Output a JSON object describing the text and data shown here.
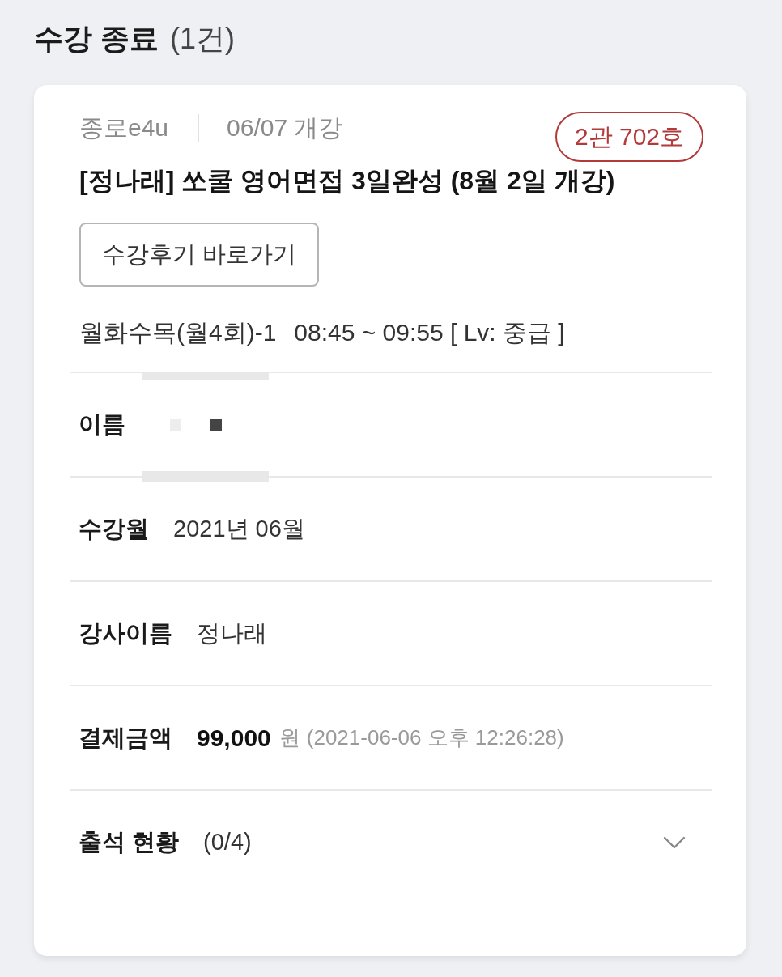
{
  "section": {
    "title": "수강 종료",
    "count": "(1건)"
  },
  "course": {
    "provider": "종로e4u",
    "start": "06/07 개강",
    "room": "2관 702호",
    "title": "[정나래] 쏘쿨 영어면접 3일완성 (8월 2일 개강)",
    "review_button": "수강후기 바로가기",
    "schedule_days": "월화수목(월4회)-1",
    "schedule_time": "08:45 ~ 09:55 [ Lv: 중급 ]"
  },
  "rows": [
    {
      "kind": "redacted",
      "label": "이름"
    },
    {
      "kind": "text",
      "label": "수강월",
      "value": "2021년 06월"
    },
    {
      "kind": "text",
      "label": "강사이름",
      "value": "정나래"
    },
    {
      "kind": "payment",
      "label": "결제금액",
      "amount": "99,000",
      "unit": "원",
      "paid_at": "(2021-06-06 오후 12:26:28)"
    },
    {
      "kind": "expandable",
      "label": "출석 현황",
      "value": "(0/4)",
      "expanded": false
    }
  ]
}
